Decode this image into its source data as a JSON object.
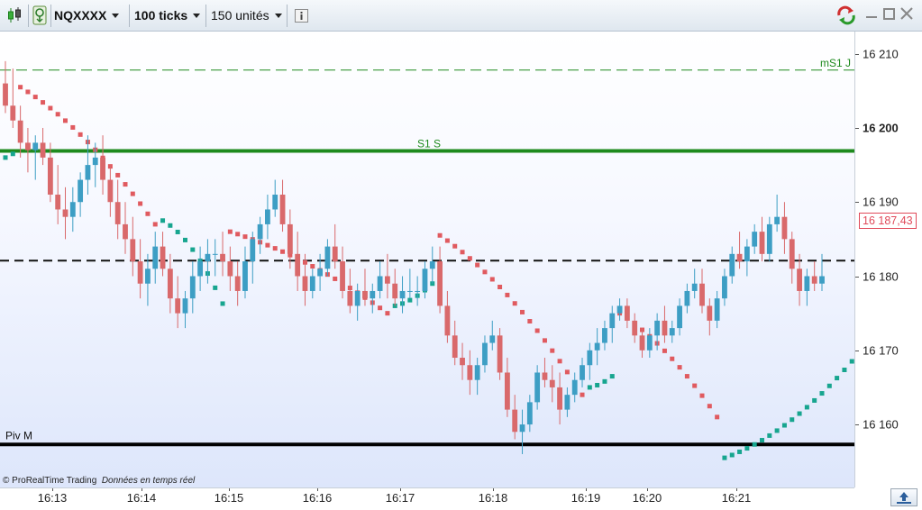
{
  "toolbar": {
    "instrument": "NQXXXX",
    "interval": "100 ticks",
    "units": "150 unités",
    "info_icon": "info-icon",
    "candle_icon": "candlestick-icon",
    "alert_icon": "alert-icon",
    "refresh_icon": "refresh-icon"
  },
  "window": {
    "minimize_icon": "minimize-icon",
    "maximize_icon": "maximize-icon",
    "close_icon": "close-icon"
  },
  "footer": {
    "copyright": "© ProRealTime Trading",
    "realtime": "Données en temps réel"
  },
  "scroll_icon": "scroll-up-icon",
  "colors": {
    "up": "#3d9ec4",
    "down": "#d9696b",
    "sar_up": "#17a58f",
    "sar_down": "#e05a5f",
    "level_green": "#1e8a1e",
    "pivot": "#000000",
    "last_price": "#e04a5a"
  },
  "chart_data": {
    "type": "candlestick",
    "ylim": [
      16151.5,
      16213
    ],
    "y_ticks": [
      {
        "value": 16210,
        "label": "16 210",
        "bold": false
      },
      {
        "value": 16200,
        "label": "16 200",
        "bold": true
      },
      {
        "value": 16190,
        "label": "16 190",
        "bold": false
      },
      {
        "value": 16180,
        "label": "16 180",
        "bold": false
      },
      {
        "value": 16170,
        "label": "16 170",
        "bold": false
      },
      {
        "value": 16160,
        "label": "16 160",
        "bold": false
      }
    ],
    "x_ticks": [
      "16:13",
      "16:14",
      "16:15",
      "16:16",
      "16:17",
      "16:18",
      "16:19",
      "16:20",
      "16:21"
    ],
    "levels": [
      {
        "name": "mS1 J",
        "value": 16207.8,
        "style": "dashed-green"
      },
      {
        "name": "S1 S",
        "value": 16196.9,
        "style": "solid-green"
      },
      {
        "name": "Piv M",
        "value": 16157.3,
        "style": "solid-black"
      },
      {
        "name": "",
        "value": 16182.1,
        "style": "dashed-black"
      }
    ],
    "last_price": {
      "value": 16187.43,
      "label": "16 187,43"
    },
    "candles": [
      [
        16206,
        16209,
        16202,
        16203
      ],
      [
        16203,
        16208,
        16200,
        16201
      ],
      [
        16201,
        16203,
        16196,
        16198
      ],
      [
        16198,
        16200,
        16194,
        16197
      ],
      [
        16197,
        16199,
        16193,
        16198
      ],
      [
        16198,
        16200,
        16195,
        16196
      ],
      [
        16196,
        16198,
        16190,
        16191
      ],
      [
        16191,
        16195,
        16187,
        16189
      ],
      [
        16189,
        16192,
        16185,
        16188
      ],
      [
        16188,
        16192,
        16186,
        16190
      ],
      [
        16190,
        16194,
        16188,
        16193
      ],
      [
        16193,
        16199,
        16191,
        16195
      ],
      [
        16195,
        16198,
        16192,
        16196
      ],
      [
        16196,
        16199,
        16191,
        16193
      ],
      [
        16193,
        16195,
        16188,
        16190
      ],
      [
        16190,
        16193,
        16185,
        16187
      ],
      [
        16187,
        16190,
        16183,
        16185
      ],
      [
        16185,
        16188,
        16180,
        16182
      ],
      [
        16182,
        16185,
        16177,
        16179
      ],
      [
        16179,
        16183,
        16176,
        16181
      ],
      [
        16181,
        16186,
        16179,
        16184
      ],
      [
        16184,
        16186,
        16180,
        16181
      ],
      [
        16181,
        16183,
        16175,
        16177
      ],
      [
        16177,
        16180,
        16173,
        16175
      ],
      [
        16175,
        16178,
        16173,
        16177
      ],
      [
        16177,
        16182,
        16175,
        16180
      ],
      [
        16180,
        16184,
        16178,
        16182
      ],
      [
        16182,
        16185,
        16179,
        16183
      ],
      [
        16183,
        16185,
        16180,
        16183
      ],
      [
        16183,
        16186,
        16180,
        16182
      ],
      [
        16182,
        16184,
        16178,
        16180
      ],
      [
        16180,
        16182,
        16176,
        16178
      ],
      [
        16178,
        16184,
        16177,
        16182
      ],
      [
        16182,
        16186,
        16179,
        16185
      ],
      [
        16185,
        16188,
        16183,
        16187
      ],
      [
        16187,
        16191,
        16185,
        16189
      ],
      [
        16189,
        16193,
        16188,
        16191
      ],
      [
        16191,
        16193,
        16186,
        16187
      ],
      [
        16187,
        16189,
        16181,
        16183
      ],
      [
        16183,
        16186,
        16178,
        16180
      ],
      [
        16180,
        16183,
        16176,
        16178
      ],
      [
        16178,
        16181,
        16177,
        16180
      ],
      [
        16180,
        16183,
        16178,
        16181
      ],
      [
        16181,
        16185,
        16180,
        16184
      ],
      [
        16184,
        16187,
        16181,
        16182
      ],
      [
        16182,
        16184,
        16177,
        16178
      ],
      [
        16178,
        16181,
        16175,
        16176
      ],
      [
        16176,
        16179,
        16174,
        16178
      ],
      [
        16178,
        16181,
        16176,
        16177
      ],
      [
        16177,
        16179,
        16175,
        16178
      ],
      [
        16178,
        16182,
        16177,
        16180
      ],
      [
        16180,
        16183,
        16177,
        16179
      ],
      [
        16179,
        16181,
        16176,
        16177
      ],
      [
        16177,
        16180,
        16175,
        16178
      ],
      [
        16178,
        16181,
        16177,
        16178
      ],
      [
        16178,
        16180,
        16176,
        16178
      ],
      [
        16178,
        16182,
        16177,
        16181
      ],
      [
        16181,
        16184,
        16179,
        16182
      ],
      [
        16182,
        16184,
        16175,
        16176
      ],
      [
        16176,
        16178,
        16171,
        16172
      ],
      [
        16172,
        16174,
        16168,
        16169
      ],
      [
        16169,
        16171,
        16166,
        16168
      ],
      [
        16168,
        16170,
        16164,
        16166
      ],
      [
        16166,
        16169,
        16164,
        16168
      ],
      [
        16168,
        16172,
        16167,
        16171
      ],
      [
        16171,
        16174,
        16170,
        16172
      ],
      [
        16172,
        16173,
        16166,
        16167
      ],
      [
        16167,
        16169,
        16161,
        16162
      ],
      [
        16162,
        16164,
        16158,
        16159
      ],
      [
        16159,
        16162,
        16156,
        16160
      ],
      [
        16160,
        16164,
        16159,
        16163
      ],
      [
        16163,
        16168,
        16162,
        16167
      ],
      [
        16167,
        16169,
        16165,
        16166
      ],
      [
        16166,
        16168,
        16163,
        16165
      ],
      [
        16165,
        16167,
        16160,
        16162
      ],
      [
        16162,
        16165,
        16161,
        16164
      ],
      [
        16164,
        16167,
        16163,
        16166
      ],
      [
        16166,
        16169,
        16165,
        16168
      ],
      [
        16168,
        16171,
        16166,
        16170
      ],
      [
        16170,
        16173,
        16168,
        16171
      ],
      [
        16171,
        16174,
        16170,
        16173
      ],
      [
        16173,
        16176,
        16171,
        16175
      ],
      [
        16175,
        16177,
        16174,
        16176
      ],
      [
        16176,
        16177,
        16173,
        16174
      ],
      [
        16174,
        16175,
        16171,
        16172
      ],
      [
        16172,
        16173,
        16169,
        16170
      ],
      [
        16170,
        16173,
        16169,
        16172
      ],
      [
        16172,
        16175,
        16170,
        16174
      ],
      [
        16174,
        16176,
        16171,
        16172
      ],
      [
        16172,
        16174,
        16171,
        16173
      ],
      [
        16173,
        16177,
        16172,
        16176
      ],
      [
        16176,
        16179,
        16175,
        16178
      ],
      [
        16178,
        16181,
        16177,
        16179
      ],
      [
        16179,
        16181,
        16175,
        16176
      ],
      [
        16176,
        16177,
        16172,
        16174
      ],
      [
        16174,
        16178,
        16173,
        16177
      ],
      [
        16177,
        16181,
        16176,
        16180
      ],
      [
        16180,
        16184,
        16179,
        16183
      ],
      [
        16183,
        16186,
        16181,
        16182
      ],
      [
        16182,
        16185,
        16180,
        16184
      ],
      [
        16184,
        16187,
        16183,
        16186
      ],
      [
        16186,
        16188,
        16182,
        16183
      ],
      [
        16183,
        16188,
        16182,
        16187
      ],
      [
        16187,
        16191,
        16186,
        16188
      ],
      [
        16188,
        16190,
        16183,
        16185
      ],
      [
        16185,
        16186,
        16179,
        16181
      ],
      [
        16181,
        16183,
        16176,
        16178
      ],
      [
        16178,
        16181,
        16176,
        16180
      ],
      [
        16180,
        16182,
        16178,
        16179
      ],
      [
        16179,
        16183,
        16178,
        16180
      ]
    ],
    "sar": [
      {
        "side": "up",
        "from": 0,
        "to": 1,
        "start": 16196,
        "end": 16196.5
      },
      {
        "side": "down",
        "from": 2,
        "to": 20,
        "start": 16205.5,
        "end": 16187
      },
      {
        "side": "up",
        "from": 21,
        "to": 29,
        "start": 16187.5,
        "end": 16176.3
      },
      {
        "side": "down",
        "from": 30,
        "to": 51,
        "start": 16186,
        "end": 16175
      },
      {
        "side": "up",
        "from": 52,
        "to": 57,
        "start": 16176,
        "end": 16179
      },
      {
        "side": "down",
        "from": 58,
        "to": 77,
        "start": 16185.5,
        "end": 16164
      },
      {
        "side": "up",
        "from": 78,
        "to": 81,
        "start": 16165,
        "end": 16166.5
      },
      {
        "side": "down",
        "from": 82,
        "to": 95,
        "start": 16175,
        "end": 16161
      },
      {
        "side": "up",
        "from": 96,
        "to": 118,
        "start": 16155.5,
        "end": 16175
      },
      {
        "side": "down",
        "from": 119,
        "to": 124,
        "start": 16179,
        "end": 16177
      },
      {
        "side": "up",
        "from": 125,
        "to": 133,
        "start": 16169,
        "end": 16175
      },
      {
        "side": "down",
        "from": 134,
        "to": 141,
        "start": 16180.5,
        "end": 16188
      }
    ]
  }
}
